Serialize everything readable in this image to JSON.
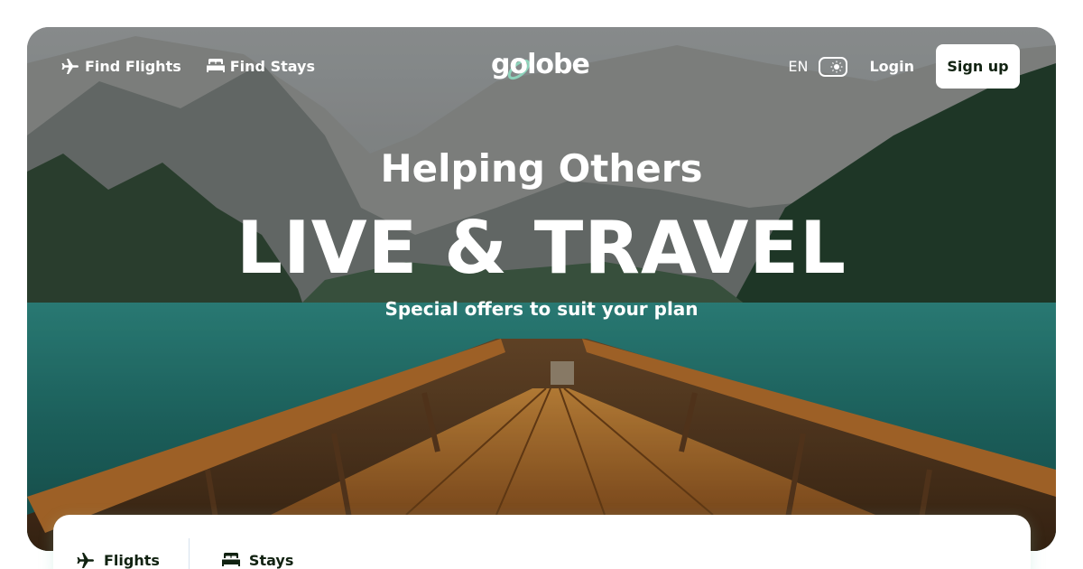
{
  "nav": {
    "find_flights": "Find Flights",
    "find_stays": "Find Stays",
    "logo_text": "golobe",
    "language": "EN",
    "login": "Login",
    "signup": "Sign up"
  },
  "hero": {
    "subtitle": "Helping Others",
    "title": "LIVE & TRAVEL",
    "tagline": "Special offers to suit your plan"
  },
  "search": {
    "tabs": [
      {
        "label": "Flights",
        "icon": "airplane-icon"
      },
      {
        "label": "Stays",
        "icon": "bed-icon"
      }
    ]
  },
  "colors": {
    "brand_dark": "#112211",
    "accent_mint": "#8DD3BB",
    "white": "#FFFFFF"
  }
}
